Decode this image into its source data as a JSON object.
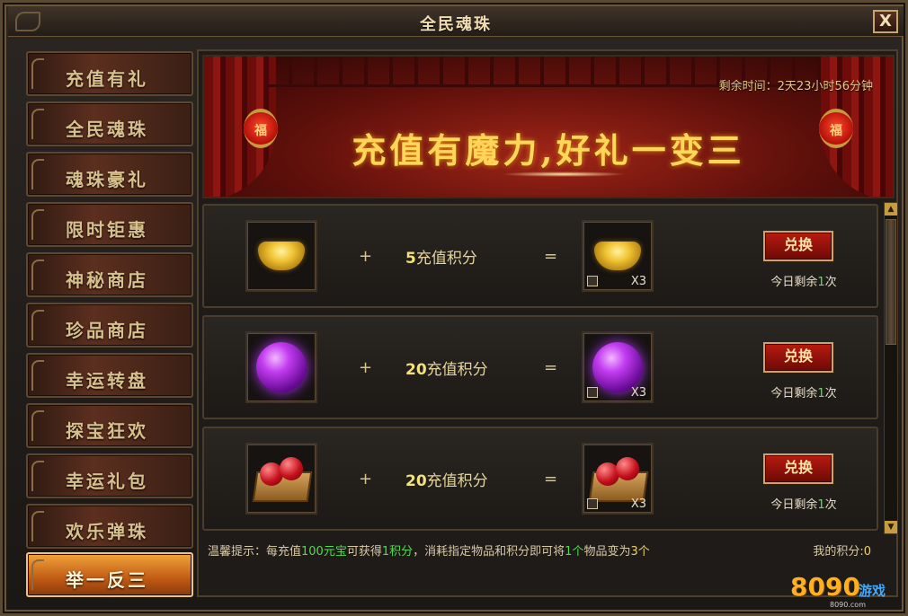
{
  "window": {
    "title": "全民魂珠",
    "close_label": "X"
  },
  "sidebar": {
    "items": [
      {
        "label": "充值有礼",
        "active": false
      },
      {
        "label": "全民魂珠",
        "active": false
      },
      {
        "label": "魂珠豪礼",
        "active": false
      },
      {
        "label": "限时钜惠",
        "active": false
      },
      {
        "label": "神秘商店",
        "active": false
      },
      {
        "label": "珍品商店",
        "active": false
      },
      {
        "label": "幸运转盘",
        "active": false
      },
      {
        "label": "探宝狂欢",
        "active": false
      },
      {
        "label": "幸运礼包",
        "active": false
      },
      {
        "label": "欢乐弹珠",
        "active": false
      },
      {
        "label": "举一反三",
        "active": true
      }
    ]
  },
  "banner": {
    "countdown": "剩余时间：2天23小时56分钟",
    "title": "充值有魔力,好礼一变三",
    "lantern_char": "福"
  },
  "rows": [
    {
      "item": "gold-ingot",
      "plus": "+",
      "points_num": "5",
      "points_text": "充值积分",
      "equals": "=",
      "qty": "X3",
      "button": "兑换",
      "remain_prefix": "今日剩余",
      "remain_count": "1",
      "remain_suffix": "次"
    },
    {
      "item": "purple-orb",
      "plus": "+",
      "points_num": "20",
      "points_text": "充值积分",
      "equals": "=",
      "qty": "X3",
      "button": "兑换",
      "remain_prefix": "今日剩余",
      "remain_count": "1",
      "remain_suffix": "次"
    },
    {
      "item": "fruit-crate",
      "plus": "+",
      "points_num": "20",
      "points_text": "充值积分",
      "equals": "=",
      "qty": "X3",
      "button": "兑换",
      "remain_prefix": "今日剩余",
      "remain_count": "1",
      "remain_suffix": "次"
    }
  ],
  "tip": {
    "p1": "温馨提示：每充值",
    "g1": "100元宝",
    "p2": "可获得",
    "g2": "1积分",
    "p3": "，消耗指定物品和积分即可将",
    "g3": "1个",
    "p4": "物品变为",
    "y1": "3个"
  },
  "my_points": {
    "label": "我的积分:",
    "value": "0"
  },
  "watermark": {
    "num": "8090",
    "text": "游戏",
    "domain": "8090.com"
  },
  "colors": {
    "accent_gold": "#f0d060",
    "green": "#4fdc4f",
    "button_red": "#b81b12"
  }
}
